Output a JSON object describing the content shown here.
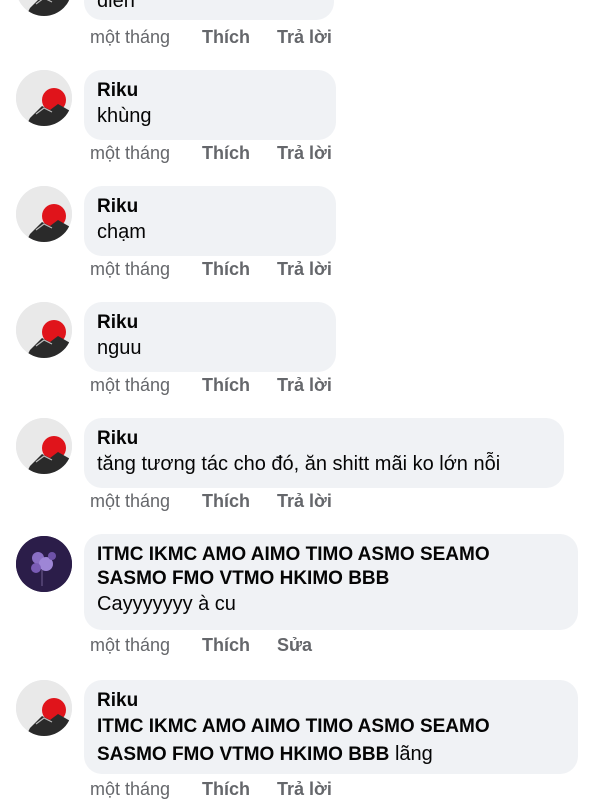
{
  "comments": [
    {
      "author": "",
      "text": "điên",
      "time": "một tháng",
      "like": "Thích",
      "reply": "Trả lời",
      "avatar": "riku-avatar"
    },
    {
      "author": "Riku",
      "text": "khùng",
      "time": "một tháng",
      "like": "Thích",
      "reply": "Trả lời",
      "avatar": "riku-avatar"
    },
    {
      "author": "Riku",
      "text": "chạm",
      "time": "một tháng",
      "like": "Thích",
      "reply": "Trả lời",
      "avatar": "riku-avatar"
    },
    {
      "author": "Riku",
      "text": "nguu",
      "time": "một tháng",
      "like": "Thích",
      "reply": "Trả lời",
      "avatar": "riku-avatar"
    },
    {
      "author": "Riku",
      "text": "tăng tương tác cho đó, ăn shitt mãi ko lớn nỗi",
      "time": "một tháng",
      "like": "Thích",
      "reply": "Trả lời",
      "avatar": "riku-avatar"
    },
    {
      "author_line1": "ITMC IKMC AMO AIMO TIMO ASMO SEAMO",
      "author_line2": "SASMO FMO VTMO HKIMO BBB",
      "text": "Cayyyyyyy à cu",
      "time": "một tháng",
      "like": "Thích",
      "reply": "Sửa",
      "avatar": "flower-avatar"
    },
    {
      "author": "Riku",
      "mention_line1": "ITMC IKMC AMO AIMO TIMO ASMO SEAMO",
      "mention_line2": "SASMO FMO VTMO HKIMO BBB",
      "text": "lãng",
      "time": "một tháng",
      "like": "Thích",
      "reply": "Trả lời",
      "avatar": "riku-avatar"
    }
  ],
  "colors": {
    "bubble": "#f0f2f5",
    "meta": "#65676b",
    "text": "#050505"
  }
}
